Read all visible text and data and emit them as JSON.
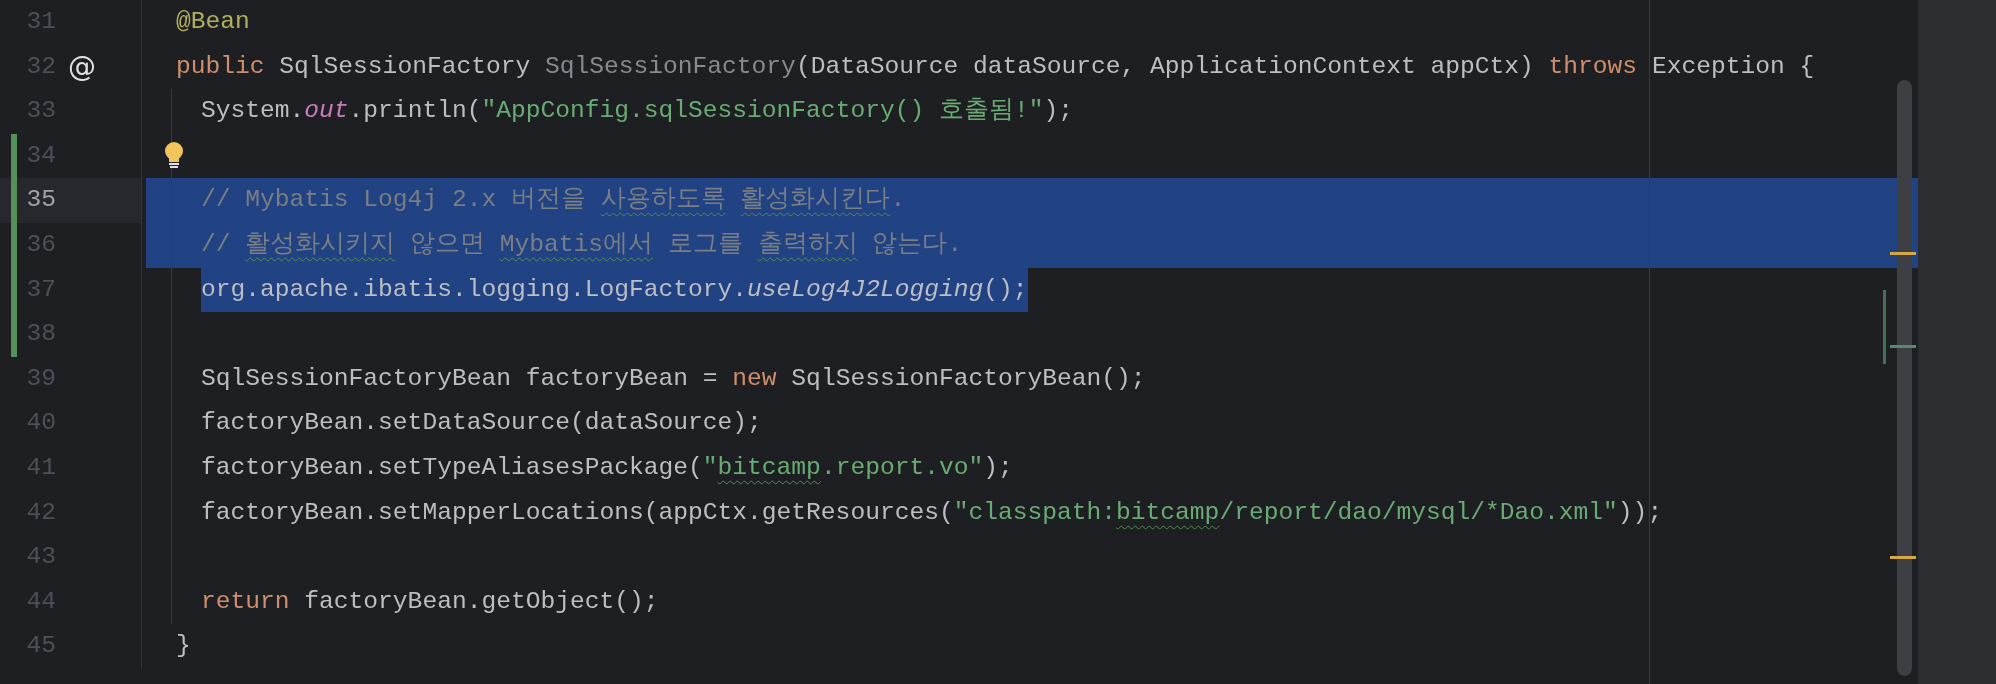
{
  "lines": [
    {
      "number": "31",
      "tokens": [
        {
          "text": "@Bean",
          "kind": "annotation"
        }
      ]
    },
    {
      "number": "32",
      "gutter_mark": "@",
      "tokens": [
        {
          "text": "public ",
          "kind": "keyword"
        },
        {
          "text": "SqlSessionFactory ",
          "kind": "plain"
        },
        {
          "text": "SqlSessionFactory",
          "kind": "unused"
        },
        {
          "text": "(DataSource dataSource, ApplicationContext appCtx) ",
          "kind": "plain"
        },
        {
          "text": "throws ",
          "kind": "keyword"
        },
        {
          "text": "Exception {",
          "kind": "plain"
        }
      ]
    },
    {
      "number": "33",
      "indented": true,
      "tokens": [
        {
          "text": "System.",
          "kind": "plain"
        },
        {
          "text": "out",
          "kind": "field"
        },
        {
          "text": ".println(",
          "kind": "plain"
        },
        {
          "text": "\"AppConfig.sqlSessionFactory() 호출됨!\"",
          "kind": "string"
        },
        {
          "text": ");",
          "kind": "plain"
        }
      ]
    },
    {
      "number": "34",
      "indented": true,
      "changed": true,
      "hint": true
    },
    {
      "number": "35",
      "indented": true,
      "changed": true,
      "current": true,
      "selected": true,
      "tokens": [
        {
          "text": "// Mybatis Log4j 2.x 버전을 ",
          "kind": "comment"
        },
        {
          "text": "사용하도록 ",
          "kind": "comment",
          "typo": true
        },
        {
          "text": "활성화시킨다",
          "kind": "comment",
          "typo": true
        },
        {
          "text": ".",
          "kind": "comment"
        }
      ]
    },
    {
      "number": "36",
      "indented": true,
      "changed": true,
      "selected": true,
      "tokens": [
        {
          "text": "// ",
          "kind": "comment"
        },
        {
          "text": "활성화시키지",
          "kind": "comment",
          "typo": true
        },
        {
          "text": " 않으면 ",
          "kind": "comment"
        },
        {
          "text": "Mybatis에서",
          "kind": "comment",
          "typo": true
        },
        {
          "text": " 로그를 ",
          "kind": "comment"
        },
        {
          "text": "출력하지",
          "kind": "comment",
          "typo": true
        },
        {
          "text": " 않는다.",
          "kind": "comment"
        }
      ]
    },
    {
      "number": "37",
      "indented": true,
      "changed": true,
      "selected": true,
      "tokens": [
        {
          "text": "org.apache.ibatis.logging.LogFactory.",
          "kind": "plain"
        },
        {
          "text": "useLog4J2Logging",
          "kind": "static"
        },
        {
          "text": "();",
          "kind": "plain"
        }
      ]
    },
    {
      "number": "38",
      "indented": true,
      "changed": true
    },
    {
      "number": "39",
      "indented": true,
      "tokens": [
        {
          "text": "SqlSessionFactoryBean factoryBean = ",
          "kind": "plain"
        },
        {
          "text": "new ",
          "kind": "keyword"
        },
        {
          "text": "SqlSessionFactoryBean();",
          "kind": "plain"
        }
      ]
    },
    {
      "number": "40",
      "indented": true,
      "tokens": [
        {
          "text": "factoryBean.setDataSource(dataSource);",
          "kind": "plain"
        }
      ]
    },
    {
      "number": "41",
      "indented": true,
      "tokens": [
        {
          "text": "factoryBean.setTypeAliasesPackage(",
          "kind": "plain"
        },
        {
          "text": "\"",
          "kind": "string"
        },
        {
          "text": "bitcamp",
          "kind": "string",
          "typo": true
        },
        {
          "text": ".report.vo\"",
          "kind": "string"
        },
        {
          "text": ");",
          "kind": "plain"
        }
      ]
    },
    {
      "number": "42",
      "indented": true,
      "tokens": [
        {
          "text": "factoryBean.setMapperLocations(appCtx.getResources(",
          "kind": "plain"
        },
        {
          "text": "\"classpath:",
          "kind": "string"
        },
        {
          "text": "bitcamp",
          "kind": "string",
          "typo": true
        },
        {
          "text": "/report/dao/mysql/*Dao.xml\"",
          "kind": "string"
        },
        {
          "text": "));",
          "kind": "plain"
        }
      ]
    },
    {
      "number": "43",
      "indented": true
    },
    {
      "number": "44",
      "indented": true,
      "tokens": [
        {
          "text": "return ",
          "kind": "keyword"
        },
        {
          "text": "factoryBean.getObject();",
          "kind": "plain"
        }
      ]
    },
    {
      "number": "45",
      "tokens": [
        {
          "text": "}",
          "kind": "plain"
        }
      ]
    }
  ]
}
